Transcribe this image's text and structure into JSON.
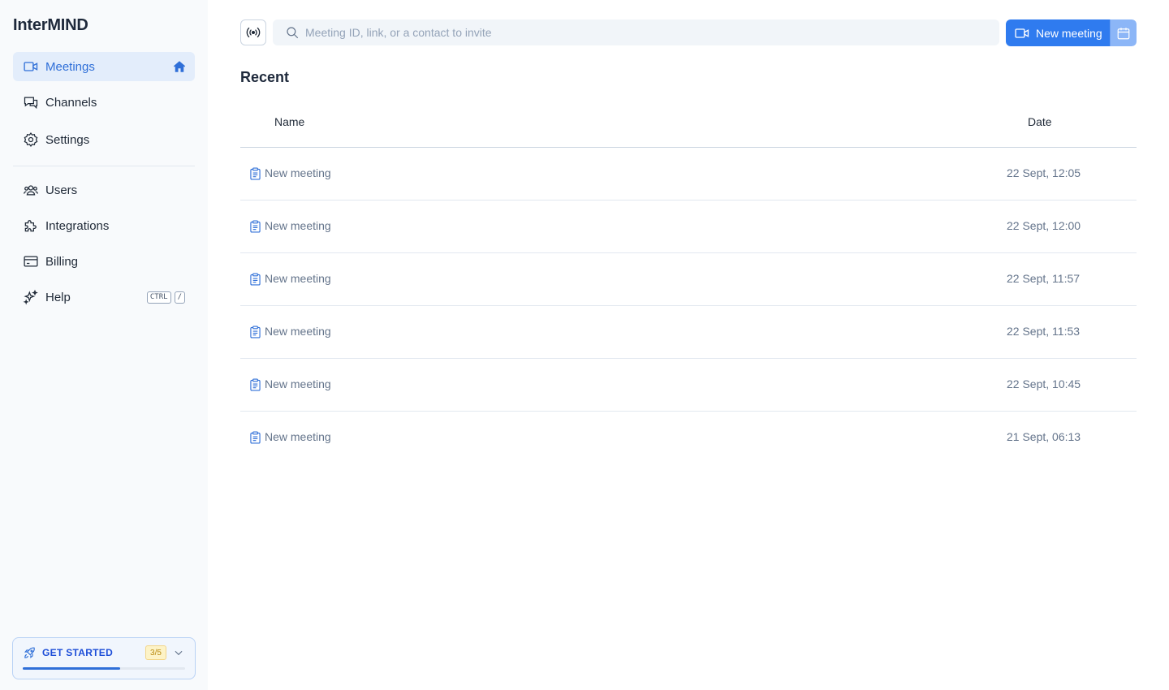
{
  "app": {
    "name": "InterMIND"
  },
  "sidebar": {
    "items": [
      {
        "label": "Meetings",
        "icon": "video-icon",
        "active": true
      },
      {
        "label": "Channels",
        "icon": "chat-icon"
      },
      {
        "label": "Settings",
        "icon": "gear-icon"
      },
      {
        "label": "Users",
        "icon": "users-icon"
      },
      {
        "label": "Integrations",
        "icon": "puzzle-icon"
      },
      {
        "label": "Billing",
        "icon": "credit-card-icon"
      },
      {
        "label": "Help",
        "icon": "sparkles-icon"
      }
    ],
    "help_shortcut": {
      "key1": "CTRL",
      "key2": "/"
    },
    "get_started": {
      "label": "GET STARTED",
      "progress_text": "3/5",
      "progress_fraction": 0.6
    }
  },
  "header": {
    "search_placeholder": "Meeting ID, link, or a contact to invite",
    "new_meeting_label": "New meeting"
  },
  "recent": {
    "title": "Recent",
    "columns": {
      "name": "Name",
      "date": "Date"
    },
    "rows": [
      {
        "name": "New meeting",
        "date": "22 Sept, 12:05"
      },
      {
        "name": "New meeting",
        "date": "22 Sept, 12:00"
      },
      {
        "name": "New meeting",
        "date": "22 Sept, 11:57"
      },
      {
        "name": "New meeting",
        "date": "22 Sept, 11:53"
      },
      {
        "name": "New meeting",
        "date": "22 Sept, 10:45"
      },
      {
        "name": "New meeting",
        "date": "21 Sept, 06:13"
      }
    ]
  },
  "colors": {
    "accent": "#2f7bef",
    "active_bg": "#e3edfb",
    "sidebar_bg": "#f8fafc",
    "badge_bg": "#fdf3c7"
  }
}
